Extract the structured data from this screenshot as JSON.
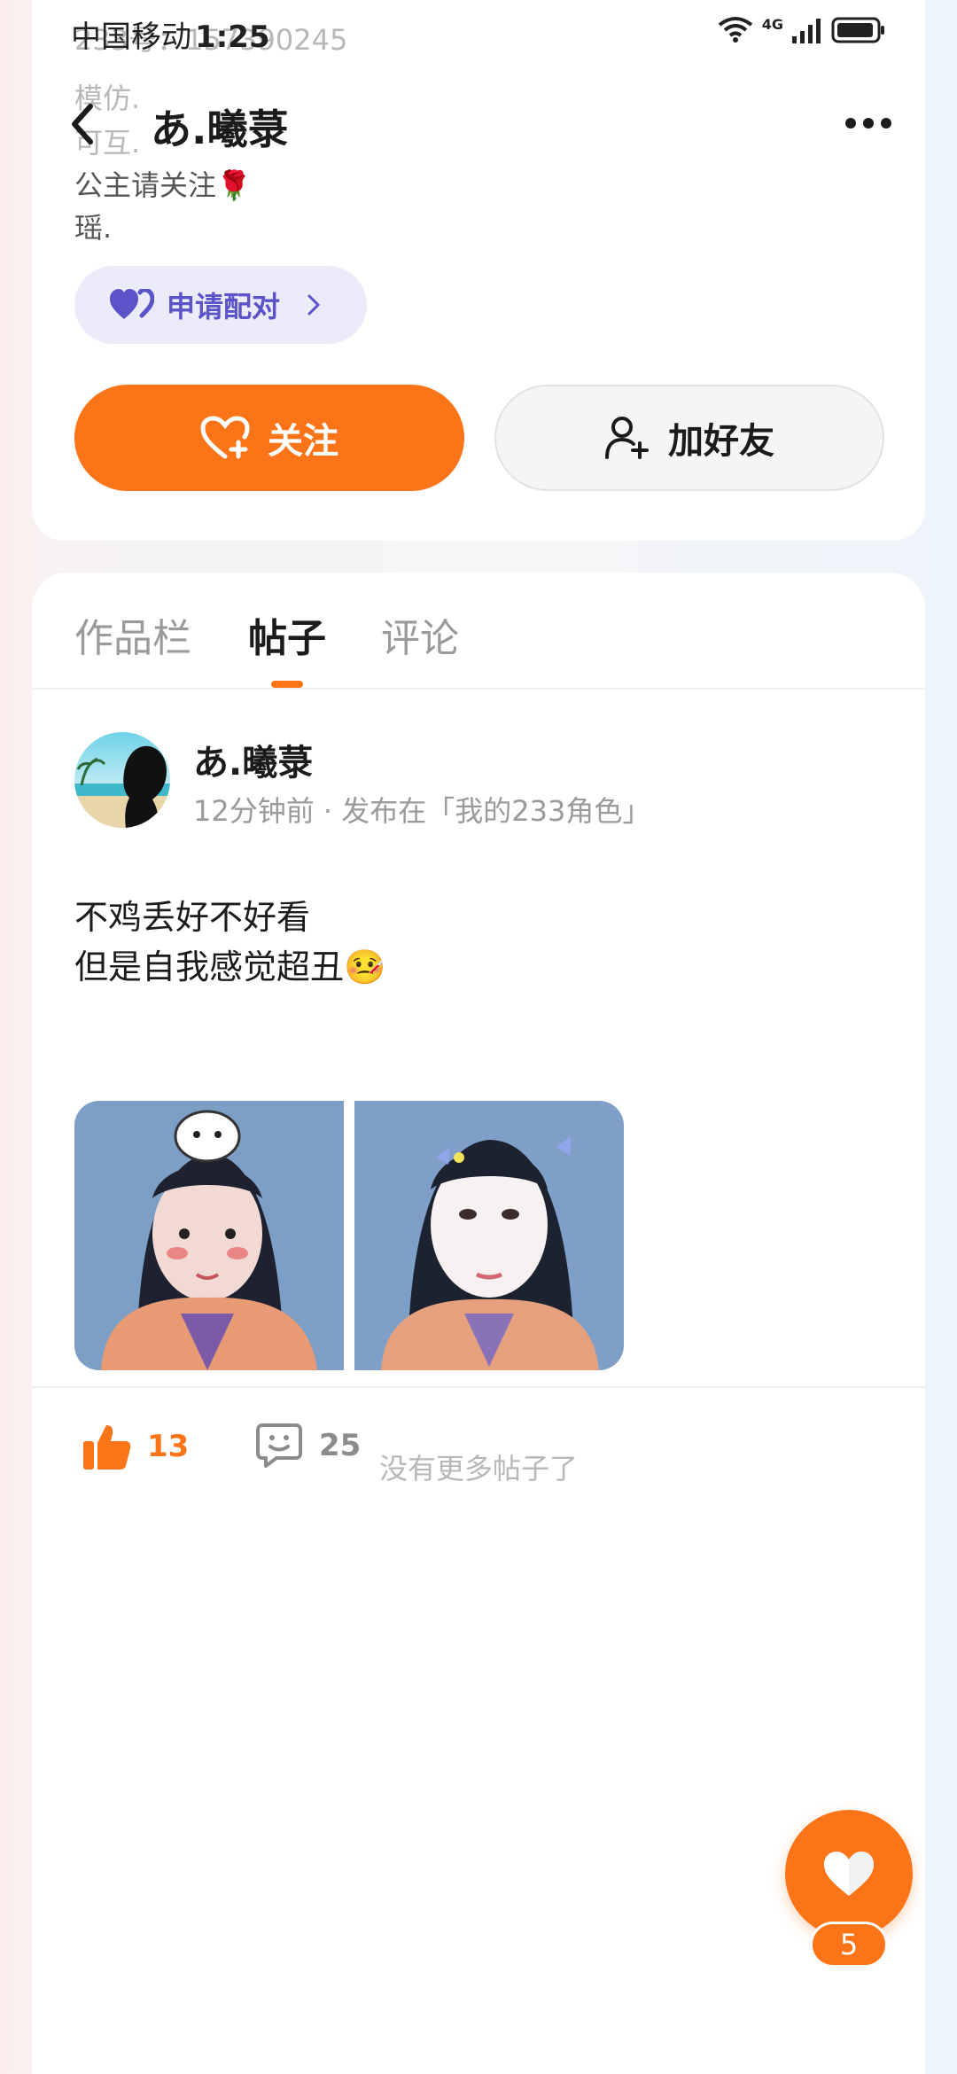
{
  "status_bar": {
    "carrier": "中国移动",
    "time": "1:25",
    "network": "4G"
  },
  "header": {
    "title": "あ.曦菉"
  },
  "profile": {
    "faded_line_1": "233号：157390245",
    "faded_line_2": "模仿.",
    "faded_line_3": "可互.",
    "bio_line_1": "公主请关注🌹",
    "bio_line_2": "瑶.",
    "pair_label": "申请配对",
    "follow_label": "关注",
    "add_friend_label": "加好友"
  },
  "tabs": [
    {
      "label": "作品栏"
    },
    {
      "label": "帖子"
    },
    {
      "label": "评论"
    }
  ],
  "post": {
    "author": "あ.曦菉",
    "meta": "12分钟前 · 发布在「我的233角色」",
    "text_line_1": "不鸡丢好不好看",
    "text_line_2": "但是自我感觉超丑🤒",
    "likes": "13",
    "comments": "25"
  },
  "footer": {
    "no_more": "没有更多帖子了"
  },
  "float_like": {
    "count": "5"
  },
  "colors": {
    "accent": "#fb7418",
    "pair_purple": "#5b54c9"
  }
}
